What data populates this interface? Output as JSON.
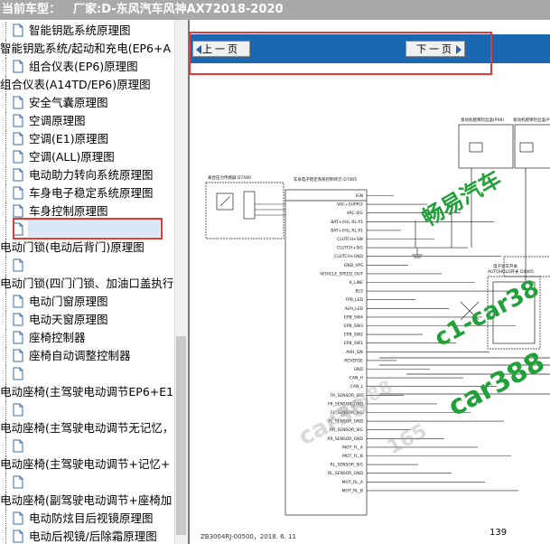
{
  "title_bar": {
    "prefix": "当前车型：",
    "model": "厂家:D-东风汽车风神AX72018-2020"
  },
  "tree": {
    "items": [
      {
        "label": "智能钥匙系统原理图",
        "kind": "doc"
      },
      {
        "label": "智能钥匙系统/起动和充电(EP6+A",
        "kind": "folder"
      },
      {
        "label": "组合仪表(EP6)原理图",
        "kind": "doc"
      },
      {
        "label": "组合仪表(A14TD/EP6)原理图",
        "kind": "folder"
      },
      {
        "label": "安全气囊原理图",
        "kind": "doc"
      },
      {
        "label": "空调原理图",
        "kind": "doc"
      },
      {
        "label": "空调(E1)原理图",
        "kind": "doc"
      },
      {
        "label": "空调(ALL)原理图",
        "kind": "doc"
      },
      {
        "label": "电动助力转向系统原理图",
        "kind": "doc"
      },
      {
        "label": "车身电子稳定系统原理图",
        "kind": "doc",
        "selected": true
      },
      {
        "label": "车身控制原理图",
        "kind": "doc"
      },
      {
        "label": "",
        "kind": "doc"
      },
      {
        "label": "电动门锁(电动后背门)原理图",
        "kind": "folder"
      },
      {
        "label": "",
        "kind": "doc"
      },
      {
        "label": "电动门锁(四门门锁、加油口盖执行",
        "kind": "folder"
      },
      {
        "label": "电动门窗原理图",
        "kind": "doc"
      },
      {
        "label": "电动天窗原理图",
        "kind": "doc"
      },
      {
        "label": "座椅控制器",
        "kind": "doc"
      },
      {
        "label": "座椅自动调整控制器",
        "kind": "doc"
      },
      {
        "label": "",
        "kind": "doc"
      },
      {
        "label": "电动座椅(主驾驶电动调节EP6+E1",
        "kind": "folder"
      },
      {
        "label": "",
        "kind": "doc"
      },
      {
        "label": "电动座椅(主驾驶电动调节无记忆，ﾉ",
        "kind": "folder"
      },
      {
        "label": "",
        "kind": "doc"
      },
      {
        "label": "电动座椅(主驾驶电动调节+记忆+",
        "kind": "folder"
      },
      {
        "label": "",
        "kind": "doc"
      },
      {
        "label": "电动座椅(副驾驶电动调节+座椅加",
        "kind": "folder"
      },
      {
        "label": "电动防炫目后视镜原理图",
        "kind": "doc"
      },
      {
        "label": "电动后视镜/后除霜原理图",
        "kind": "doc"
      }
    ]
  },
  "nav": {
    "prev_label": "上一页",
    "next_label": "下一页"
  },
  "schematic": {
    "labels": {
      "ecu_title": "车身电子稳定系统控制单元 D7005",
      "sensor_title": "离合压力传感器 D7440",
      "ign": "IGN",
      "vac_supply": "VAC+SUPPLY",
      "vac_sig": "VAC-SIG",
      "bat_hl": "BAT+(H)L.RL.P1",
      "bat_hl2": "BAT+(H)L.RL.P1",
      "clutch_sw": "CLUTCH+SW",
      "clutch_sig": "CLUTCH+SIG",
      "clutch_gnd": "CLUTCH+GND",
      "gnd_vps": "GND_VPS",
      "vehicle_speed": "VEHICLE_SPEED_OUT",
      "k_line": "K_LINE",
      "bls": "BLS",
      "fpb_led": "FPB_LED",
      "avh_led": "AVH_LED",
      "epb_sw4": "EPB_SW4",
      "epb_sw3": "EPB_SW3",
      "epb_sw2": "EPB_SW2",
      "epb_sw1": "EPB_SW1",
      "avh_sw": "AVH_SW",
      "reverse": "REVERSE",
      "gnd": "GND",
      "can_h": "CAN_H",
      "can_l": "CAN_L",
      "fr_sensor_sig": "FR_SENSOR_SIG",
      "fr_sensor_gnd": "FR_SENSOR_GND",
      "fl_sensor_sig": "FL_SENSOR_SIG",
      "fl_sensor_gnd": "FL_SENSOR_GND",
      "rr_sensor_sig": "RR_SENSOR_SIG",
      "rr_sensor_gnd": "RR_SENSOR_GND",
      "mot_fla": "MOT_FL_A",
      "mot_flb": "MOT_FL_B",
      "rl_sensor_sig": "RL_SENSOR_SIG",
      "rl_sensor_gnd": "RL_SENSOR_GND",
      "mot_rla": "MOT_RL_A",
      "mot_rlb": "MOT_RL_B",
      "epb_switch": "电子驻车开关",
      "fuse_box_top": "发动机舱保险丝盒(P08)",
      "fuse_box_top2": "发动机舱保险丝盒(P",
      "connector_d4405": "AUTOHOLD开关 D4405"
    },
    "footer_code": "ZB3004RJ-00500，2018. 6. 11",
    "page_number": "139"
  },
  "watermarks": {
    "brand": "畅易汽车",
    "site1": "c1-car38",
    "site2": "car388",
    "site3": "car38",
    "site4": "car388",
    "phone": "165"
  },
  "colors": {
    "titlebar_bg": "#a9a9a9",
    "nav_bg": "#1b67b2",
    "selection_border": "#e53935",
    "watermark_green": "#22a03a"
  }
}
